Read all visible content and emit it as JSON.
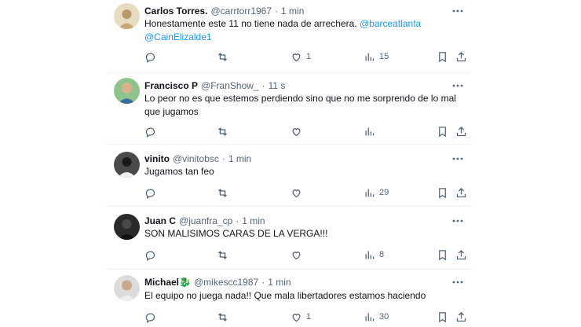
{
  "tweets": [
    {
      "name": "Carlos Torres.",
      "handle": "@carrtorr1967",
      "time": "1 min",
      "text": "Honestamente este 11 no tiene nada de arrechera.",
      "mentions": [
        "@barceatlanta",
        "@CainElizalde1"
      ],
      "likes": "1",
      "views": "15",
      "avatar_color": "#d9c7a1"
    },
    {
      "name": "Francisco P",
      "handle": "@FranShow_",
      "time": "11 s",
      "text": "Lo peor no es que estemos perdiendo sino que no me sorprendo de lo mal que jugamos",
      "likes": "",
      "views": "",
      "avatar_color": "#5a9a5a"
    },
    {
      "name": "vinito",
      "handle": "@vinitobsc",
      "time": "1 min",
      "text": "Jugamos tan feo",
      "likes": "",
      "views": "29",
      "avatar_color": "#2f2f2f"
    },
    {
      "name": "Juan C",
      "handle": "@juanfra_cp",
      "time": "1 min",
      "text": "SON MALISIMOS CARAS DE LA VERGA!!!",
      "likes": "",
      "views": "8",
      "avatar_color": "#1f1f1f"
    },
    {
      "name": "Michael🐉",
      "handle": "@mikescc1987",
      "time": "1 min",
      "text": "El equipo no juega nada!! Que mala libertadores estamos haciendo",
      "likes": "1",
      "views": "30",
      "avatar_color": "#c9c9c9"
    }
  ],
  "separator": "·",
  "icons": [
    "more-icon",
    "reply-icon",
    "retweet-icon",
    "like-icon",
    "views-icon",
    "bookmark-icon",
    "share-icon"
  ],
  "colors": {
    "link": "#1d9bf0",
    "muted": "#536471",
    "text": "#0f1419",
    "divider": "#eff3f4"
  }
}
